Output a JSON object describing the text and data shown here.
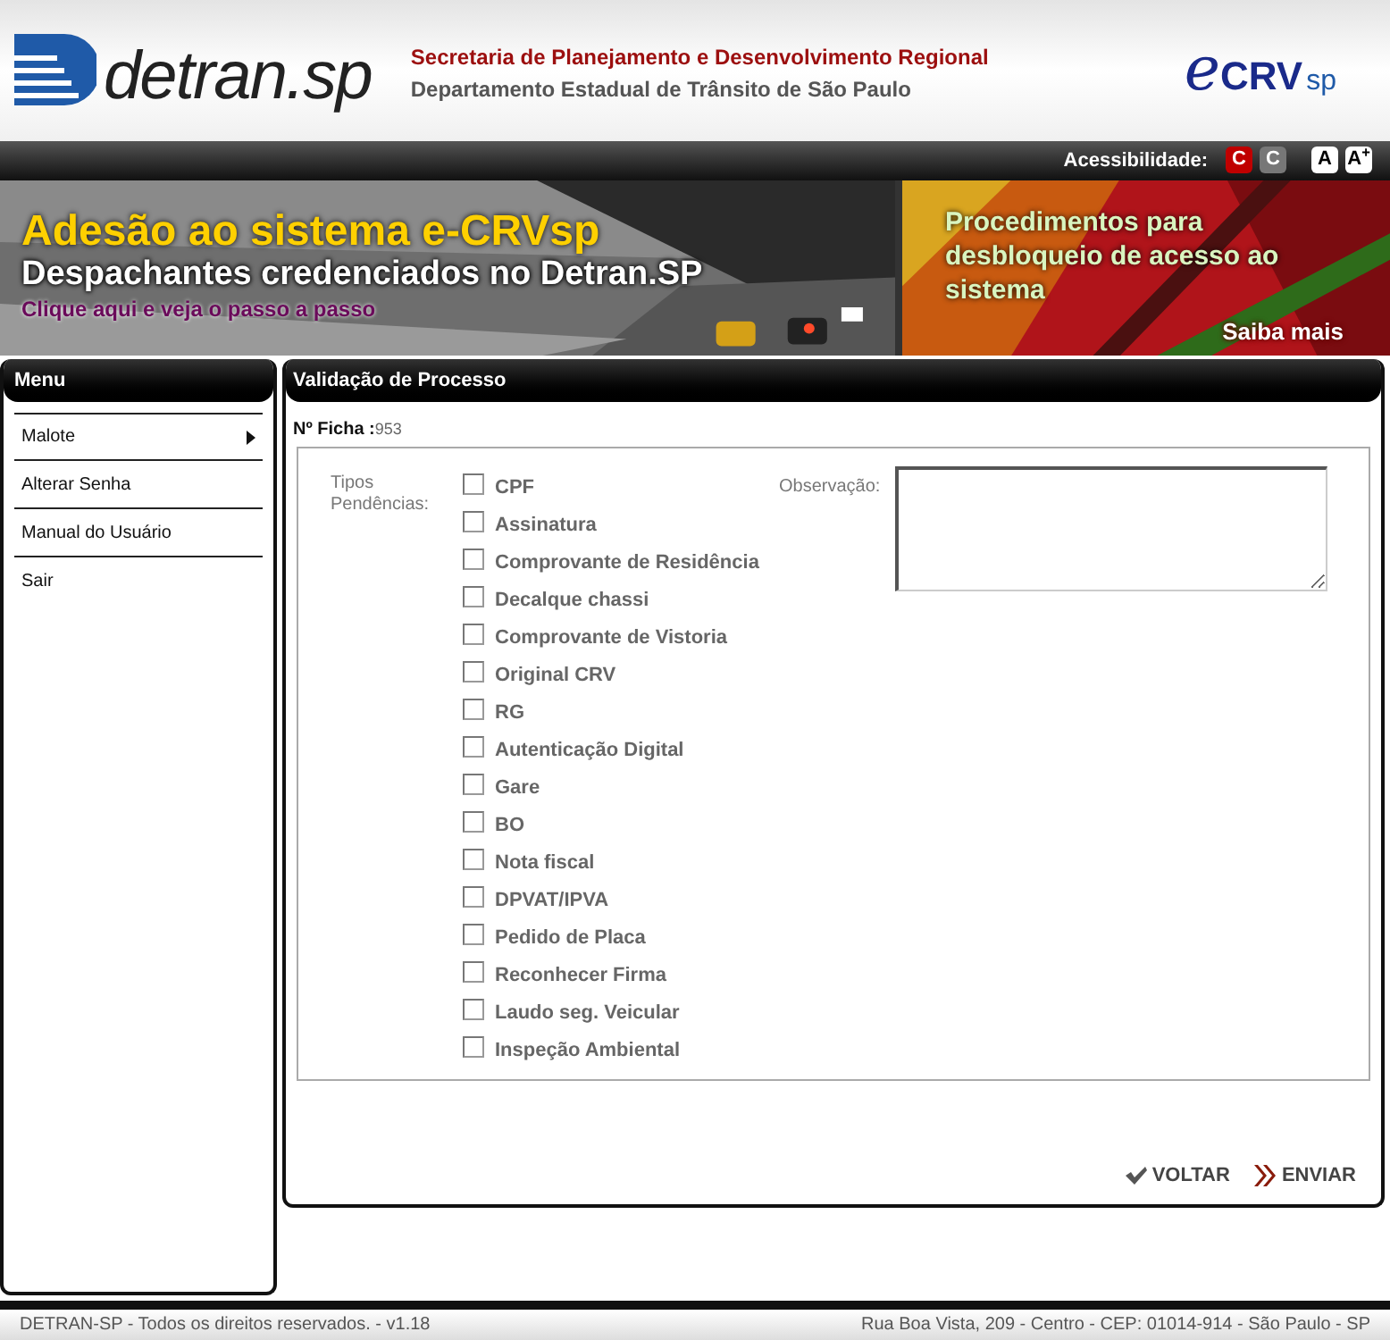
{
  "header": {
    "logo": "detran.sp",
    "secretaria": "Secretaria de Planejamento e Desenvolvimento Regional",
    "departamento": "Departamento Estadual de Trânsito de São Paulo",
    "ecrv": {
      "e": "e",
      "main": "CRV",
      "suffix": "sp"
    }
  },
  "accessibility": {
    "label": "Acessibilidade:",
    "buttons": [
      {
        "text": "C",
        "kind": "contrast-red"
      },
      {
        "text": "C",
        "kind": "contrast-gray"
      },
      {
        "text": "A",
        "kind": "font"
      },
      {
        "text": "A$^{+}$",
        "kind": "font"
      }
    ]
  },
  "banners": [
    {
      "title": "Adesão ao sistema e-CRVsp",
      "subtitle": "Despachantes credenciados no Detran.SP",
      "link": "Clique aqui e veja o passo a passo"
    },
    {
      "title": "Procedimentos para desbloqueio de acesso ao sistema",
      "link": "Saiba mais"
    }
  ],
  "menu": {
    "title": "Menu",
    "items": [
      {
        "label": "Malote",
        "submenu": true
      },
      {
        "label": "Alterar Senha",
        "submenu": false
      },
      {
        "label": "Manual do Usuário",
        "submenu": false
      },
      {
        "label": "Sair",
        "submenu": false
      }
    ]
  },
  "panel": {
    "title": "Validação de Processo",
    "ficha_label": "Nº Ficha :",
    "ficha_value": "953",
    "pendencias_label": "Tipos Pendências:",
    "observacao_label": "Observação:",
    "pendencias": [
      {
        "label": "CPF",
        "checked": false
      },
      {
        "label": "Assinatura",
        "checked": false
      },
      {
        "label": "Comprovante de Residência",
        "checked": false
      },
      {
        "label": "Decalque chassi",
        "checked": false
      },
      {
        "label": "Comprovante de Vistoria",
        "checked": false
      },
      {
        "label": "Original CRV",
        "checked": false
      },
      {
        "label": "RG",
        "checked": false
      },
      {
        "label": "Autenticação Digital",
        "checked": false
      },
      {
        "label": "Gare",
        "checked": false
      },
      {
        "label": "BO",
        "checked": false
      },
      {
        "label": "Nota fiscal",
        "checked": false
      },
      {
        "label": "DPVAT/IPVA",
        "checked": false
      },
      {
        "label": "Pedido de Placa",
        "checked": false
      },
      {
        "label": "Reconhecer Firma",
        "checked": false
      },
      {
        "label": "Laudo seg. Veicular",
        "checked": false
      },
      {
        "label": "Inspeção Ambiental",
        "checked": false
      }
    ],
    "actions": [
      {
        "label": "VOLTAR",
        "kind": "back"
      },
      {
        "label": "ENVIAR",
        "kind": "send"
      }
    ]
  },
  "footer": {
    "left": "DETRAN-SP - Todos os direitos reservados. - v1.18",
    "right": "Rua Boa Vista, 209 - Centro - CEP: 01014-914 - São Paulo - SP"
  }
}
